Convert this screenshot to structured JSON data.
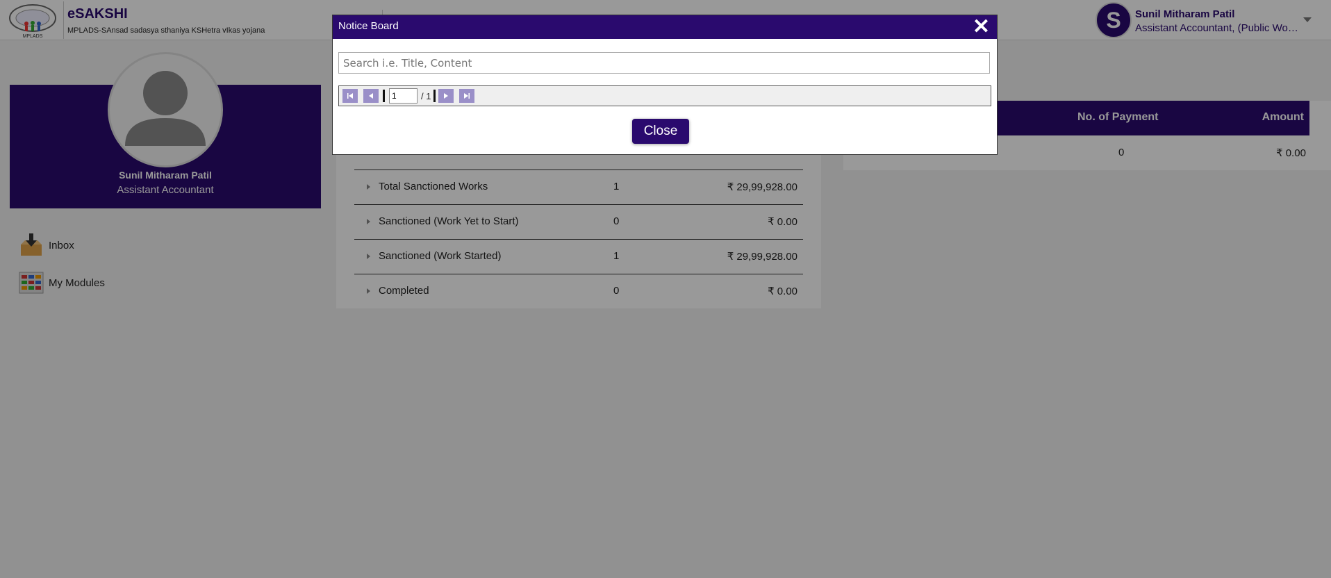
{
  "header": {
    "app_title": "eSAKSHI",
    "app_subtitle": "MPLADS-SAnsad sadasya sthaniya KSHetra vIkas yojana",
    "logo_label": "MPLADS",
    "user_initial": "S",
    "user_name": "Sunil Mitharam Patil",
    "user_role": "Assistant Accountant, (Public Works Department)"
  },
  "profile": {
    "name": "Sunil Mitharam Patil",
    "role": "Assistant Accountant"
  },
  "sidebar": {
    "items": [
      {
        "label": "Inbox",
        "icon": "inbox-icon"
      },
      {
        "label": "My Modules",
        "icon": "modules-icon"
      }
    ]
  },
  "summary": {
    "rows": [
      {
        "label": "Total Sanctioned Works",
        "count": "1",
        "amount": "₹ 29,99,928.00"
      },
      {
        "label": "Sanctioned (Work Yet to Start)",
        "count": "0",
        "amount": "₹ 0.00"
      },
      {
        "label": "Sanctioned (Work Started)",
        "count": "1",
        "amount": "₹ 29,99,928.00"
      },
      {
        "label": "Completed",
        "count": "0",
        "amount": "₹ 0.00"
      }
    ]
  },
  "payments": {
    "col_count": "No. of Payment",
    "col_amount": "Amount",
    "count": "0",
    "amount": "₹ 0.00"
  },
  "modal": {
    "title": "Notice Board",
    "close_x": "✕",
    "search_placeholder": "Search i.e. Title, Content",
    "page_value": "1",
    "page_total": "/ 1",
    "close_label": "Close"
  },
  "colors": {
    "brand": "#2a0a6e",
    "pager_button": "#9a8fc8"
  }
}
